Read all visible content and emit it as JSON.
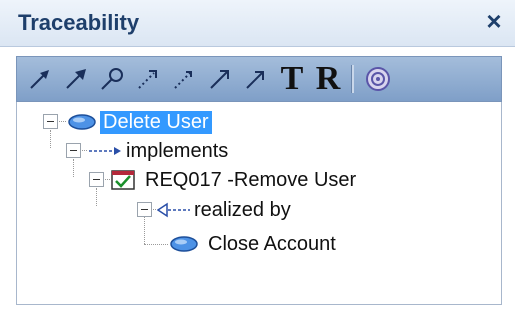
{
  "panel": {
    "title": "Traceability",
    "close_symbol": "×"
  },
  "toolbar": {
    "buttons": [
      {
        "icon": "trace-arrow-icon"
      },
      {
        "icon": "trace-arrow-bold-icon"
      },
      {
        "icon": "trace-search-icon"
      },
      {
        "icon": "trace-dotted-up-icon"
      },
      {
        "icon": "trace-dotted-down-icon"
      },
      {
        "icon": "trace-arrow-alt-icon"
      },
      {
        "icon": "trace-arrow-alt2-icon"
      },
      {
        "label": "T"
      },
      {
        "label": "R"
      },
      {
        "icon": "help-icon"
      }
    ]
  },
  "tree": {
    "nodes": [
      {
        "label": "Delete User",
        "icon": "use-case-icon"
      },
      {
        "label": "implements",
        "icon": "implements-arrow-icon"
      },
      {
        "label": "REQ017 -Remove User",
        "icon": "requirement-icon"
      },
      {
        "label": "realized by",
        "icon": "realized-by-arrow-icon"
      },
      {
        "label": "Close Account",
        "icon": "use-case-icon"
      }
    ]
  },
  "colors": {
    "selection": "#3399ff",
    "title_text": "#1e3f6b",
    "toolbar": "#8faed4"
  }
}
